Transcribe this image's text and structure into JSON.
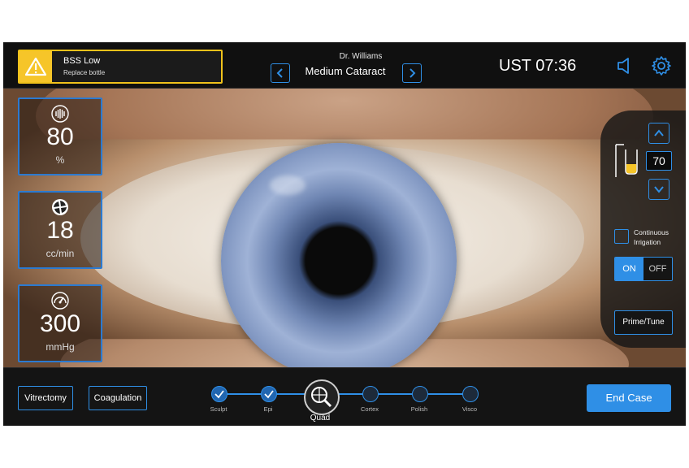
{
  "alert": {
    "title": "BSS Low",
    "subtitle": "Replace bottle",
    "icon": "warning-icon",
    "color": "#f6c529"
  },
  "header": {
    "surgeon": "Dr. Williams",
    "procedure": "Medium Cataract",
    "time": "UST 07:36",
    "prev_icon": "chevron-left-icon",
    "next_icon": "chevron-right-icon",
    "speaker_icon": "speaker-icon",
    "settings_icon": "gear-icon"
  },
  "params": [
    {
      "icon": "ultrasound-power-icon",
      "value": "80",
      "unit": "%"
    },
    {
      "icon": "aspiration-flow-icon",
      "value": "18",
      "unit": "cc/min"
    },
    {
      "icon": "vacuum-gauge-icon",
      "value": "300",
      "unit": "mmHg"
    }
  ],
  "irrigation": {
    "bottle_height": "70",
    "continuous_label_line1": "Continuous",
    "continuous_label_line2": "Irrigation",
    "continuous_checked": false,
    "toggle_on": "ON",
    "toggle_off": "OFF",
    "toggle_state": "ON",
    "prime_label": "Prime/Tune"
  },
  "bottom": {
    "vitrectomy": "Vitrectomy",
    "coagulation": "Coagulation",
    "end_case": "End Case",
    "steps": [
      {
        "label": "Sculpt",
        "status": "done"
      },
      {
        "label": "Epi",
        "status": "done"
      },
      {
        "label": "Quad",
        "status": "active"
      },
      {
        "label": "Cortex",
        "status": "pending"
      },
      {
        "label": "Polish",
        "status": "pending"
      },
      {
        "label": "Visco",
        "status": "pending"
      }
    ]
  },
  "colors": {
    "accent": "#2f8fe6",
    "warning": "#f6c529"
  }
}
